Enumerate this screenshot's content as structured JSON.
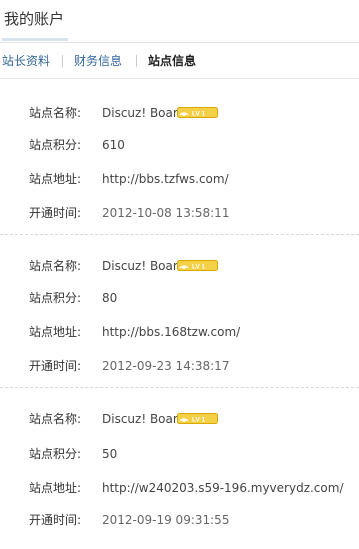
{
  "header": {
    "title": "我的账户"
  },
  "tabs": [
    {
      "label": "站长资料",
      "active": false
    },
    {
      "label": "财务信息",
      "active": false
    },
    {
      "label": "站点信息",
      "active": true
    }
  ],
  "labels": {
    "name": "站点名称:",
    "points": "站点积分:",
    "address": "站点地址:",
    "opened": "开通时间:"
  },
  "badge": {
    "icon": "signal-icon",
    "text": "LV 1",
    "color": "#f0c419"
  },
  "sites": [
    {
      "name": "Discuz! Board",
      "points": "610",
      "address": "http://bbs.tzfws.com/",
      "opened": "2012-10-08 13:58:11"
    },
    {
      "name": "Discuz! Board",
      "points": "80",
      "address": "http://bbs.168tzw.com/",
      "opened": "2012-09-23 14:38:17"
    },
    {
      "name": "Discuz! Board",
      "points": "50",
      "address": "http://w240203.s59-196.myverydz.com/",
      "opened": "2012-09-19 09:31:55"
    }
  ]
}
